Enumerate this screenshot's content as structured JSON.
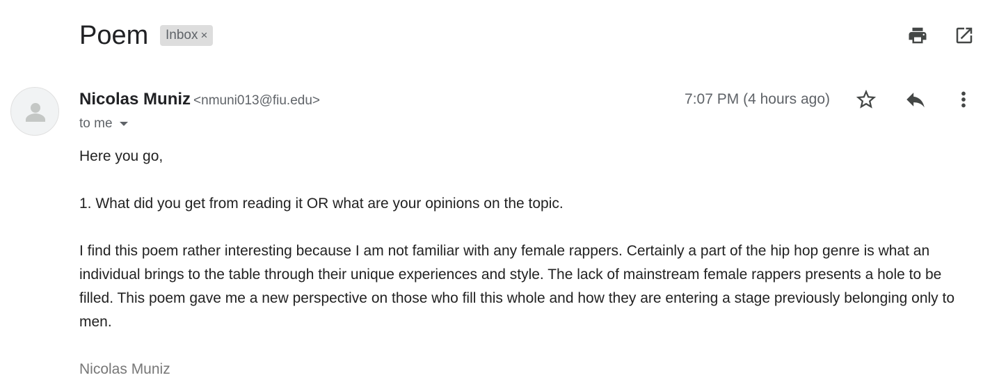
{
  "subject": "Poem",
  "label": {
    "text": "Inbox",
    "close": "×"
  },
  "toolbar": {
    "print_icon": "print-icon",
    "open_new_window_icon": "open-in-new-window-icon"
  },
  "sender": {
    "name": "Nicolas Muniz",
    "email": "<nmuni013@fiu.edu>",
    "avatar_icon": "default-person-icon"
  },
  "recipient": {
    "text": "to me"
  },
  "time": "7:07 PM (4 hours ago)",
  "actions": {
    "star_icon": "star-outline-icon",
    "reply_icon": "reply-icon",
    "more_icon": "more-vertical-icon"
  },
  "body": {
    "greeting": "Here you go,",
    "question": "1. What did you get from reading it OR what are your opinions on the topic.",
    "answer": "I find this poem rather interesting because I am not familiar with any female rappers. Certainly a part of the hip hop genre is what an individual brings to the table through their unique experiences and style. The lack of mainstream female rappers presents a hole to be filled. This poem gave me a new perspective on those who fill this whole and how they are entering a stage previously belonging only to men.",
    "signature": "Nicolas Muniz"
  },
  "colors": {
    "text_primary": "#202124",
    "text_secondary": "#5f6368",
    "chip_bg": "#dddddd",
    "icon": "#444746",
    "signature": "#777777"
  }
}
